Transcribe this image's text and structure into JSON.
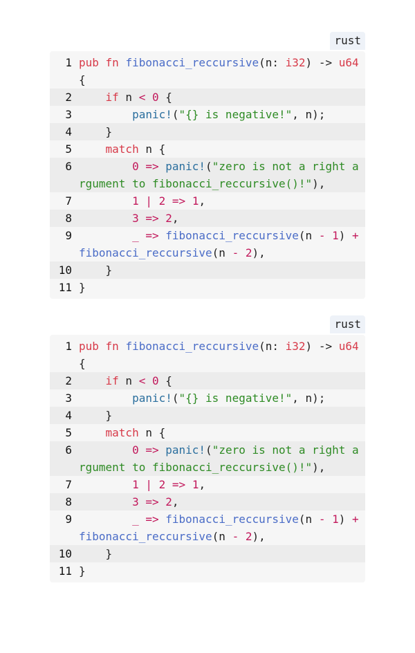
{
  "blocks": [
    {
      "language": "rust",
      "lines": [
        {
          "n": "1",
          "tokens": [
            [
              "kw",
              "pub"
            ],
            [
              "plain",
              " "
            ],
            [
              "kw",
              "fn"
            ],
            [
              "plain",
              " "
            ],
            [
              "fn",
              "fibonacci_reccursive"
            ],
            [
              "plain",
              "(n: "
            ],
            [
              "ty",
              "i32"
            ],
            [
              "plain",
              ") -> "
            ],
            [
              "ty",
              "u64"
            ],
            [
              "plain",
              " {"
            ]
          ]
        },
        {
          "n": "2",
          "tokens": [
            [
              "plain",
              "    "
            ],
            [
              "kw",
              "if"
            ],
            [
              "plain",
              " n "
            ],
            [
              "op",
              "<"
            ],
            [
              "plain",
              " "
            ],
            [
              "num",
              "0"
            ],
            [
              "plain",
              " {"
            ]
          ]
        },
        {
          "n": "3",
          "tokens": [
            [
              "plain",
              "        "
            ],
            [
              "mac",
              "panic!"
            ],
            [
              "plain",
              "("
            ],
            [
              "str",
              "\"{} is negative!\""
            ],
            [
              "plain",
              ", n);"
            ]
          ]
        },
        {
          "n": "4",
          "tokens": [
            [
              "plain",
              "    }"
            ]
          ]
        },
        {
          "n": "5",
          "tokens": [
            [
              "plain",
              "    "
            ],
            [
              "kw",
              "match"
            ],
            [
              "plain",
              " n {"
            ]
          ]
        },
        {
          "n": "6",
          "tokens": [
            [
              "plain",
              "        "
            ],
            [
              "num",
              "0"
            ],
            [
              "plain",
              " "
            ],
            [
              "op",
              "=>"
            ],
            [
              "plain",
              " "
            ],
            [
              "mac",
              "panic!"
            ],
            [
              "plain",
              "("
            ],
            [
              "str",
              "\"zero is not a right argument to fibonacci_reccursive()!\""
            ],
            [
              "plain",
              "),"
            ]
          ]
        },
        {
          "n": "7",
          "tokens": [
            [
              "plain",
              "        "
            ],
            [
              "num",
              "1"
            ],
            [
              "plain",
              " "
            ],
            [
              "op",
              "|"
            ],
            [
              "plain",
              " "
            ],
            [
              "num",
              "2"
            ],
            [
              "plain",
              " "
            ],
            [
              "op",
              "=>"
            ],
            [
              "plain",
              " "
            ],
            [
              "num",
              "1"
            ],
            [
              "plain",
              ","
            ]
          ]
        },
        {
          "n": "8",
          "tokens": [
            [
              "plain",
              "        "
            ],
            [
              "num",
              "3"
            ],
            [
              "plain",
              " "
            ],
            [
              "op",
              "=>"
            ],
            [
              "plain",
              " "
            ],
            [
              "num",
              "2"
            ],
            [
              "plain",
              ","
            ]
          ]
        },
        {
          "n": "9",
          "tokens": [
            [
              "plain",
              "        "
            ],
            [
              "op",
              "_"
            ],
            [
              "plain",
              " "
            ],
            [
              "op",
              "=>"
            ],
            [
              "plain",
              " "
            ],
            [
              "fn",
              "fibonacci_reccursive"
            ],
            [
              "plain",
              "(n "
            ],
            [
              "op",
              "-"
            ],
            [
              "plain",
              " "
            ],
            [
              "num",
              "1"
            ],
            [
              "plain",
              ") "
            ],
            [
              "op",
              "+"
            ],
            [
              "plain",
              " "
            ],
            [
              "fn",
              "fibonacci_reccursive"
            ],
            [
              "plain",
              "(n "
            ],
            [
              "op",
              "-"
            ],
            [
              "plain",
              " "
            ],
            [
              "num",
              "2"
            ],
            [
              "plain",
              "),"
            ]
          ]
        },
        {
          "n": "10",
          "tokens": [
            [
              "plain",
              "    }"
            ]
          ]
        },
        {
          "n": "11",
          "tokens": [
            [
              "plain",
              "}"
            ]
          ]
        }
      ]
    },
    {
      "language": "rust",
      "lines": [
        {
          "n": "1",
          "tokens": [
            [
              "kw",
              "pub"
            ],
            [
              "plain",
              " "
            ],
            [
              "kw",
              "fn"
            ],
            [
              "plain",
              " "
            ],
            [
              "fn",
              "fibonacci_reccursive"
            ],
            [
              "plain",
              "(n: "
            ],
            [
              "ty",
              "i32"
            ],
            [
              "plain",
              ") -> "
            ],
            [
              "ty",
              "u64"
            ],
            [
              "plain",
              " {"
            ]
          ]
        },
        {
          "n": "2",
          "tokens": [
            [
              "plain",
              "    "
            ],
            [
              "kw",
              "if"
            ],
            [
              "plain",
              " n "
            ],
            [
              "op",
              "<"
            ],
            [
              "plain",
              " "
            ],
            [
              "num",
              "0"
            ],
            [
              "plain",
              " {"
            ]
          ]
        },
        {
          "n": "3",
          "tokens": [
            [
              "plain",
              "        "
            ],
            [
              "mac",
              "panic!"
            ],
            [
              "plain",
              "("
            ],
            [
              "str",
              "\"{} is negative!\""
            ],
            [
              "plain",
              ", n);"
            ]
          ]
        },
        {
          "n": "4",
          "tokens": [
            [
              "plain",
              "    }"
            ]
          ]
        },
        {
          "n": "5",
          "tokens": [
            [
              "plain",
              "    "
            ],
            [
              "kw",
              "match"
            ],
            [
              "plain",
              " n {"
            ]
          ]
        },
        {
          "n": "6",
          "tokens": [
            [
              "plain",
              "        "
            ],
            [
              "num",
              "0"
            ],
            [
              "plain",
              " "
            ],
            [
              "op",
              "=>"
            ],
            [
              "plain",
              " "
            ],
            [
              "mac",
              "panic!"
            ],
            [
              "plain",
              "("
            ],
            [
              "str",
              "\"zero is not a right argument to fibonacci_reccursive()!\""
            ],
            [
              "plain",
              "),"
            ]
          ]
        },
        {
          "n": "7",
          "tokens": [
            [
              "plain",
              "        "
            ],
            [
              "num",
              "1"
            ],
            [
              "plain",
              " "
            ],
            [
              "op",
              "|"
            ],
            [
              "plain",
              " "
            ],
            [
              "num",
              "2"
            ],
            [
              "plain",
              " "
            ],
            [
              "op",
              "=>"
            ],
            [
              "plain",
              " "
            ],
            [
              "num",
              "1"
            ],
            [
              "plain",
              ","
            ]
          ]
        },
        {
          "n": "8",
          "tokens": [
            [
              "plain",
              "        "
            ],
            [
              "num",
              "3"
            ],
            [
              "plain",
              " "
            ],
            [
              "op",
              "=>"
            ],
            [
              "plain",
              " "
            ],
            [
              "num",
              "2"
            ],
            [
              "plain",
              ","
            ]
          ]
        },
        {
          "n": "9",
          "tokens": [
            [
              "plain",
              "        "
            ],
            [
              "op",
              "_"
            ],
            [
              "plain",
              " "
            ],
            [
              "op",
              "=>"
            ],
            [
              "plain",
              " "
            ],
            [
              "fn",
              "fibonacci_reccursive"
            ],
            [
              "plain",
              "(n "
            ],
            [
              "op",
              "-"
            ],
            [
              "plain",
              " "
            ],
            [
              "num",
              "1"
            ],
            [
              "plain",
              ") "
            ],
            [
              "op",
              "+"
            ],
            [
              "plain",
              " "
            ],
            [
              "fn",
              "fibonacci_reccursive"
            ],
            [
              "plain",
              "(n "
            ],
            [
              "op",
              "-"
            ],
            [
              "plain",
              " "
            ],
            [
              "num",
              "2"
            ],
            [
              "plain",
              "),"
            ]
          ]
        },
        {
          "n": "10",
          "tokens": [
            [
              "plain",
              "    }"
            ]
          ]
        },
        {
          "n": "11",
          "tokens": [
            [
              "plain",
              "}"
            ]
          ]
        }
      ]
    }
  ]
}
